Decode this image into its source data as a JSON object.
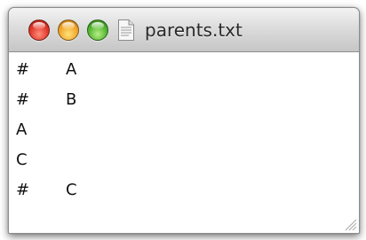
{
  "window": {
    "title": "parents.txt",
    "title_icon": "text-document-icon",
    "buttons": {
      "close": "close-icon",
      "minimize": "minimize-icon",
      "zoom": "zoom-icon"
    },
    "accent_colors": {
      "close": "#e0372b",
      "minimize": "#f1a52a",
      "zoom": "#52b532"
    }
  },
  "content": {
    "lines": [
      {
        "c1": "#",
        "c2": "A"
      },
      {
        "c1": "#",
        "c2": "B"
      },
      {
        "c1": "A",
        "c2": ""
      },
      {
        "c1": "C",
        "c2": ""
      },
      {
        "c1": "#",
        "c2": "C"
      }
    ]
  }
}
